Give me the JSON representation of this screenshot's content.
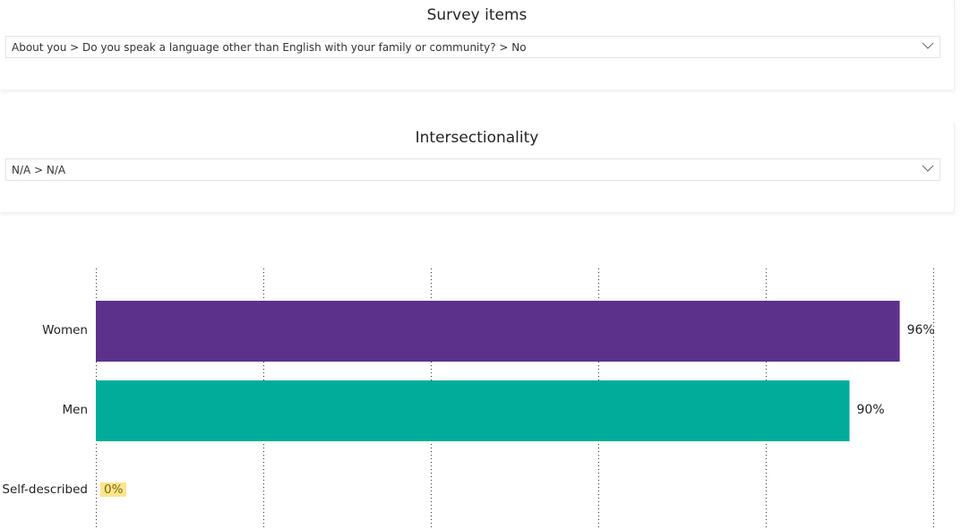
{
  "survey_card": {
    "title": "Survey items",
    "selected": "About you > Do you speak a language other than English with your family or community? > No",
    "chevron_icon": "chevron-down-icon"
  },
  "intersect_card": {
    "title": "Intersectionality",
    "selected": "N/A > N/A",
    "chevron_icon": "chevron-down-icon"
  },
  "chart_data": {
    "type": "bar",
    "orientation": "horizontal",
    "categories": [
      "Women",
      "Men",
      "Self-described"
    ],
    "values": [
      96,
      90,
      0
    ],
    "data_labels": [
      "96%",
      "90%",
      "0%"
    ],
    "colors": [
      "#5c318b",
      "#01ac9a",
      "#fbe58f"
    ],
    "xlim": [
      0,
      100
    ],
    "x_gridlines": [
      0,
      20,
      40,
      60,
      80,
      100
    ],
    "grid": "dotted vertical",
    "title": "",
    "xlabel": "",
    "ylabel": ""
  }
}
